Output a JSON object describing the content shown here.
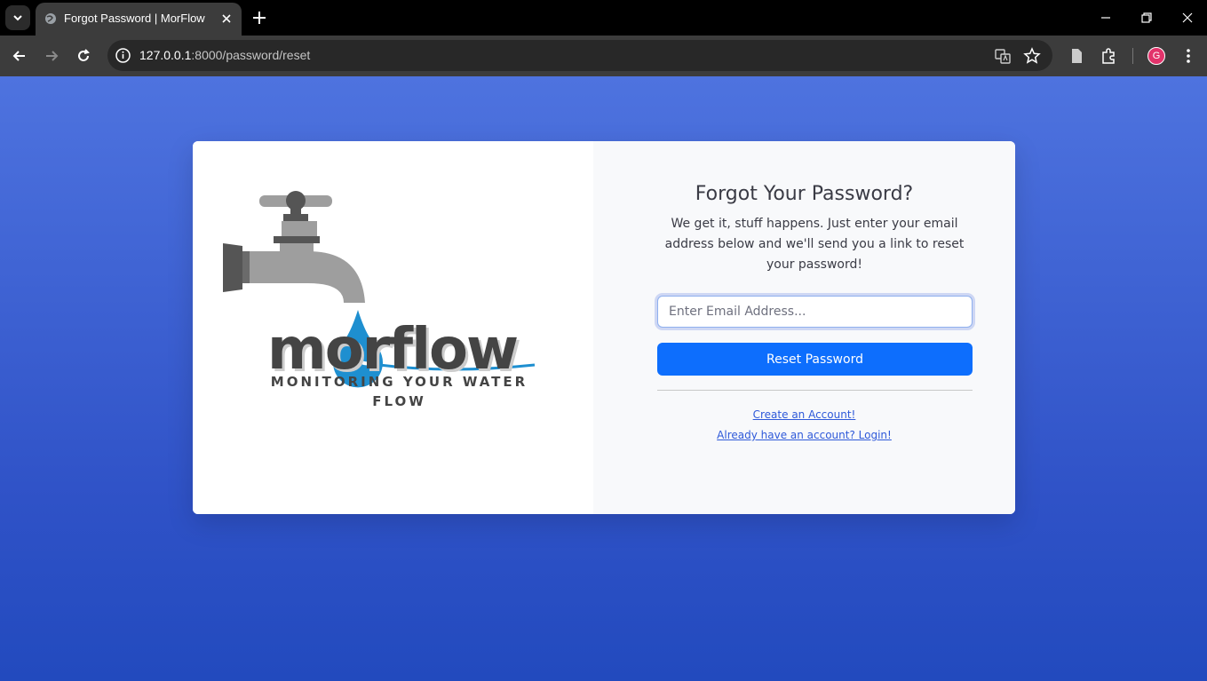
{
  "browser": {
    "tab": {
      "title": "Forgot Password | MorFlow"
    },
    "address_bar": {
      "host": "127.0.0.1",
      "path": ":8000/password/reset"
    },
    "profile_initial": "G"
  },
  "brand": {
    "logo_text": "morflow",
    "tagline": "MONITORING YOUR WATER FLOW",
    "colors": {
      "water": "#1e8fd0",
      "metal": "#9e9e9e",
      "dark": "#4a4a4a"
    }
  },
  "form": {
    "heading": "Forgot Your Password?",
    "description": "We get it, stuff happens. Just enter your email address below and we'll send you a link to reset your password!",
    "email_placeholder": "Enter Email Address...",
    "submit_label": "Reset Password"
  },
  "links": {
    "create_account": "Create an Account!",
    "login": "Already have an account? Login!"
  },
  "colors": {
    "page_background": "#4e73df",
    "button": "#0d6efd",
    "link": "#2e59d9"
  }
}
